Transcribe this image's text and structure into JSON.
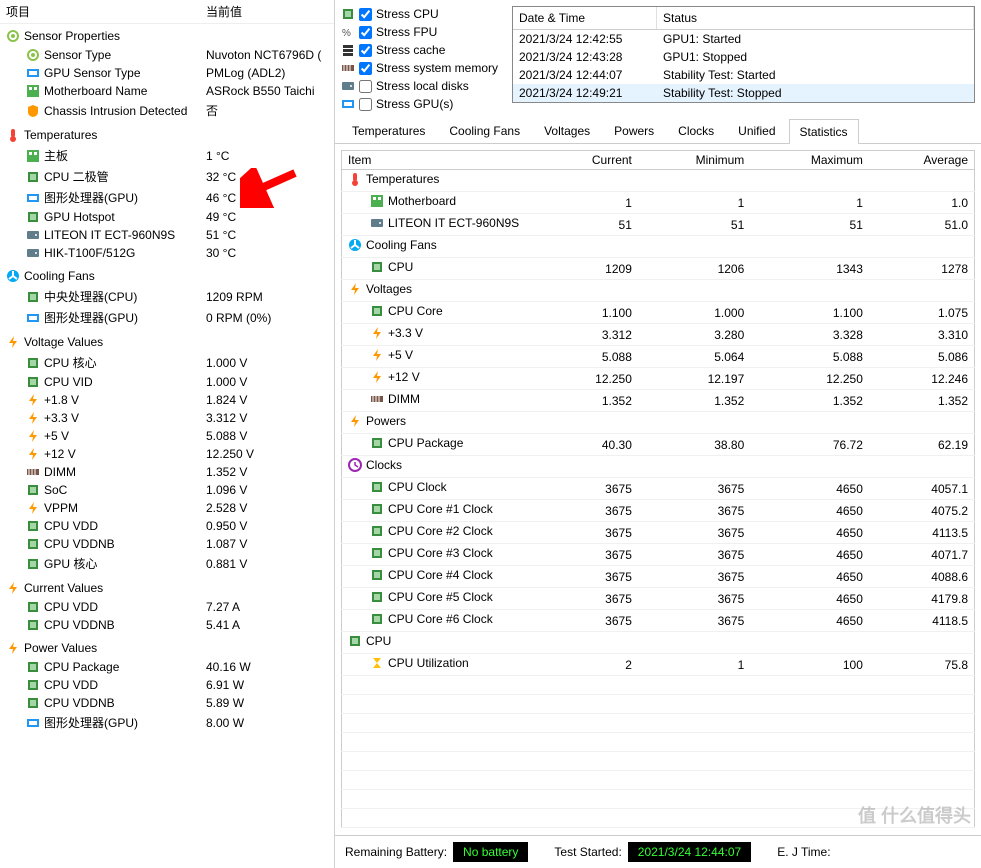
{
  "left": {
    "header": {
      "item": "项目",
      "value": "当前值"
    },
    "groups": [
      {
        "title": "Sensor Properties",
        "icon": "sensor",
        "rows": [
          {
            "icon": "sensor",
            "label": "Sensor Type",
            "value": "Nuvoton NCT6796D  ("
          },
          {
            "icon": "gpu",
            "label": "GPU Sensor Type",
            "value": "PMLog  (ADL2)"
          },
          {
            "icon": "mb",
            "label": "Motherboard Name",
            "value": "ASRock B550 Taichi"
          },
          {
            "icon": "shield",
            "label": "Chassis Intrusion Detected",
            "value": "否"
          }
        ]
      },
      {
        "title": "Temperatures",
        "icon": "temp",
        "rows": [
          {
            "icon": "mb",
            "label": "主板",
            "value": "1 °C"
          },
          {
            "icon": "chip",
            "label": "CPU 二极管",
            "value": "32 °C"
          },
          {
            "icon": "gpu",
            "label": "图形处理器(GPU)",
            "value": "46 °C"
          },
          {
            "icon": "chip",
            "label": "GPU Hotspot",
            "value": "49 °C"
          },
          {
            "icon": "disk",
            "label": "LITEON IT ECT-960N9S",
            "value": "51 °C"
          },
          {
            "icon": "disk",
            "label": "HIK-T100F/512G",
            "value": "30 °C"
          }
        ]
      },
      {
        "title": "Cooling Fans",
        "icon": "fan",
        "rows": [
          {
            "icon": "chip",
            "label": "中央处理器(CPU)",
            "value": "1209 RPM"
          },
          {
            "icon": "gpu",
            "label": "图形处理器(GPU)",
            "value": "0 RPM  (0%)"
          }
        ]
      },
      {
        "title": "Voltage Values",
        "icon": "volt",
        "rows": [
          {
            "icon": "chip",
            "label": "CPU 核心",
            "value": "1.000 V"
          },
          {
            "icon": "chip",
            "label": "CPU VID",
            "value": "1.000 V"
          },
          {
            "icon": "volt",
            "label": "+1.8 V",
            "value": "1.824 V"
          },
          {
            "icon": "volt",
            "label": "+3.3 V",
            "value": "3.312 V"
          },
          {
            "icon": "volt",
            "label": "+5 V",
            "value": "5.088 V"
          },
          {
            "icon": "volt",
            "label": "+12 V",
            "value": "12.250 V"
          },
          {
            "icon": "dimm",
            "label": "DIMM",
            "value": "1.352 V"
          },
          {
            "icon": "chip",
            "label": "SoC",
            "value": "1.096 V"
          },
          {
            "icon": "volt",
            "label": "VPPM",
            "value": "2.528 V"
          },
          {
            "icon": "chip",
            "label": "CPU VDD",
            "value": "0.950 V"
          },
          {
            "icon": "chip",
            "label": "CPU VDDNB",
            "value": "1.087 V"
          },
          {
            "icon": "chip",
            "label": "GPU 核心",
            "value": "0.881 V"
          }
        ]
      },
      {
        "title": "Current Values",
        "icon": "volt",
        "rows": [
          {
            "icon": "chip",
            "label": "CPU VDD",
            "value": "7.27 A"
          },
          {
            "icon": "chip",
            "label": "CPU VDDNB",
            "value": "5.41 A"
          }
        ]
      },
      {
        "title": "Power Values",
        "icon": "volt",
        "rows": [
          {
            "icon": "chip",
            "label": "CPU Package",
            "value": "40.16 W"
          },
          {
            "icon": "chip",
            "label": "CPU VDD",
            "value": "6.91 W"
          },
          {
            "icon": "chip",
            "label": "CPU VDDNB",
            "value": "5.89 W"
          },
          {
            "icon": "gpu",
            "label": "图形处理器(GPU)",
            "value": "8.00 W"
          }
        ]
      }
    ]
  },
  "stress": [
    {
      "icon": "chip",
      "label": "Stress CPU",
      "checked": true
    },
    {
      "icon": "percent",
      "label": "Stress FPU",
      "checked": true
    },
    {
      "icon": "cache",
      "label": "Stress cache",
      "checked": true
    },
    {
      "icon": "dimm",
      "label": "Stress system memory",
      "checked": true
    },
    {
      "icon": "disk",
      "label": "Stress local disks",
      "checked": false
    },
    {
      "icon": "gpu",
      "label": "Stress GPU(s)",
      "checked": false
    }
  ],
  "log": {
    "header": {
      "dt": "Date & Time",
      "status": "Status"
    },
    "rows": [
      {
        "dt": "2021/3/24 12:42:55",
        "status": "GPU1: Started"
      },
      {
        "dt": "2021/3/24 12:43:28",
        "status": "GPU1: Stopped"
      },
      {
        "dt": "2021/3/24 12:44:07",
        "status": "Stability Test: Started"
      },
      {
        "dt": "2021/3/24 12:49:21",
        "status": "Stability Test: Stopped",
        "selected": true
      }
    ]
  },
  "tabs": [
    "Temperatures",
    "Cooling Fans",
    "Voltages",
    "Powers",
    "Clocks",
    "Unified",
    "Statistics"
  ],
  "activeTab": "Statistics",
  "stats": {
    "columns": [
      "Item",
      "Current",
      "Minimum",
      "Maximum",
      "Average"
    ],
    "sections": [
      {
        "name": "Temperatures",
        "icon": "temp",
        "rows": [
          {
            "name": "Motherboard",
            "icon": "mb",
            "cur": "1",
            "min": "1",
            "max": "1",
            "avg": "1.0"
          },
          {
            "name": "LITEON IT ECT-960N9S",
            "icon": "disk",
            "cur": "51",
            "min": "51",
            "max": "51",
            "avg": "51.0"
          }
        ]
      },
      {
        "name": "Cooling Fans",
        "icon": "fan",
        "rows": [
          {
            "name": "CPU",
            "icon": "chip",
            "cur": "1209",
            "min": "1206",
            "max": "1343",
            "avg": "1278"
          }
        ]
      },
      {
        "name": "Voltages",
        "icon": "volt",
        "rows": [
          {
            "name": "CPU Core",
            "icon": "chip",
            "cur": "1.100",
            "min": "1.000",
            "max": "1.100",
            "avg": "1.075"
          },
          {
            "name": "+3.3 V",
            "icon": "volt",
            "cur": "3.312",
            "min": "3.280",
            "max": "3.328",
            "avg": "3.310"
          },
          {
            "name": "+5 V",
            "icon": "volt",
            "cur": "5.088",
            "min": "5.064",
            "max": "5.088",
            "avg": "5.086"
          },
          {
            "name": "+12 V",
            "icon": "volt",
            "cur": "12.250",
            "min": "12.197",
            "max": "12.250",
            "avg": "12.246"
          },
          {
            "name": "DIMM",
            "icon": "dimm",
            "cur": "1.352",
            "min": "1.352",
            "max": "1.352",
            "avg": "1.352"
          }
        ]
      },
      {
        "name": "Powers",
        "icon": "volt",
        "rows": [
          {
            "name": "CPU Package",
            "icon": "chip",
            "cur": "40.30",
            "min": "38.80",
            "max": "76.72",
            "avg": "62.19"
          }
        ]
      },
      {
        "name": "Clocks",
        "icon": "clock",
        "rows": [
          {
            "name": "CPU Clock",
            "icon": "chip",
            "cur": "3675",
            "min": "3675",
            "max": "4650",
            "avg": "4057.1"
          },
          {
            "name": "CPU Core #1 Clock",
            "icon": "chip",
            "cur": "3675",
            "min": "3675",
            "max": "4650",
            "avg": "4075.2"
          },
          {
            "name": "CPU Core #2 Clock",
            "icon": "chip",
            "cur": "3675",
            "min": "3675",
            "max": "4650",
            "avg": "4113.5"
          },
          {
            "name": "CPU Core #3 Clock",
            "icon": "chip",
            "cur": "3675",
            "min": "3675",
            "max": "4650",
            "avg": "4071.7"
          },
          {
            "name": "CPU Core #4 Clock",
            "icon": "chip",
            "cur": "3675",
            "min": "3675",
            "max": "4650",
            "avg": "4088.6"
          },
          {
            "name": "CPU Core #5 Clock",
            "icon": "chip",
            "cur": "3675",
            "min": "3675",
            "max": "4650",
            "avg": "4179.8"
          },
          {
            "name": "CPU Core #6 Clock",
            "icon": "chip",
            "cur": "3675",
            "min": "3675",
            "max": "4650",
            "avg": "4118.5"
          }
        ]
      },
      {
        "name": "CPU",
        "icon": "chip",
        "rows": [
          {
            "name": "CPU Utilization",
            "icon": "hourglass",
            "cur": "2",
            "min": "1",
            "max": "100",
            "avg": "75.8"
          }
        ]
      }
    ]
  },
  "statusbar": {
    "battery_label": "Remaining Battery:",
    "battery_value": "No battery",
    "test_started_label": "Test Started:",
    "test_started_value": "2021/3/24 12:44:07",
    "elapsed_label": "E.       J Time:"
  },
  "watermark": "值  什么值得头"
}
